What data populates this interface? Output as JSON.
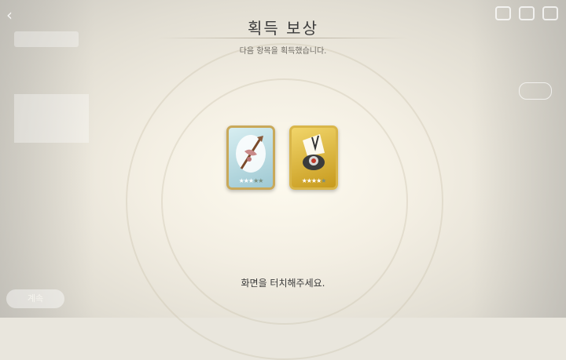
{
  "header": {
    "title": "획득 보상",
    "subtitle": "다음 항목을 획득했습니다."
  },
  "rewards": [
    {
      "name": "rare-weapon",
      "frame": "blue",
      "stars_filled": 3,
      "stars_total": 5
    },
    {
      "name": "gold-trophy",
      "frame": "gold",
      "stars_filled": 4,
      "stars_total": 5
    }
  ],
  "footer": {
    "hint": "화면을 터치해주세요.",
    "background_button": "계속"
  },
  "icons": {
    "back": "back-arrow-icon",
    "top_right": [
      "mail-icon",
      "chat-icon",
      "exit-icon"
    ]
  }
}
